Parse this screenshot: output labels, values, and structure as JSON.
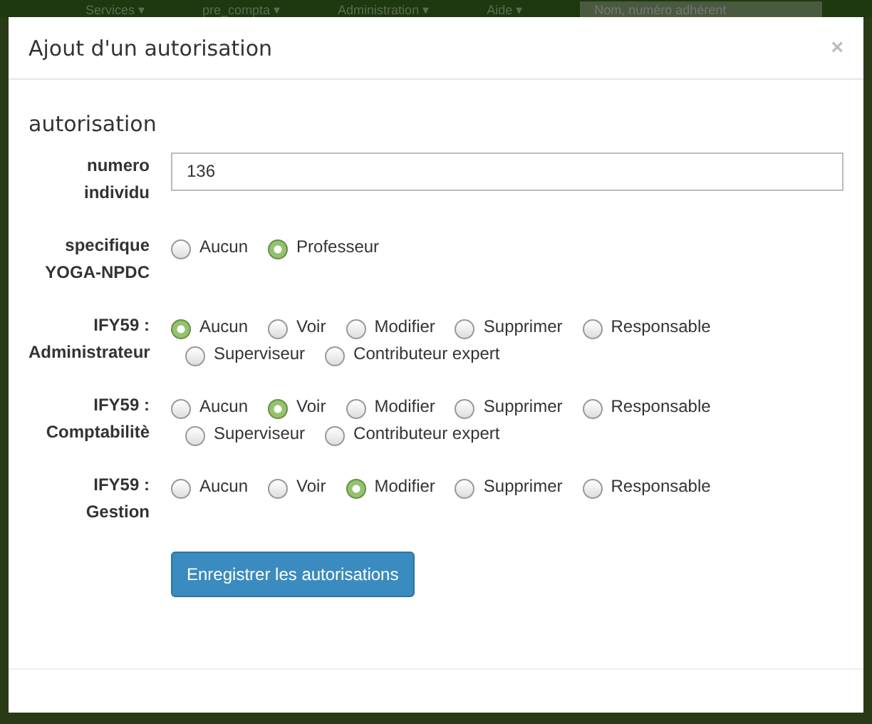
{
  "background_nav": {
    "items": [
      "Services ▾",
      "pre_compta ▾",
      "Administration ▾",
      "Aide ▾"
    ],
    "search": {
      "placeholder": "Nom, numéro adhérent"
    }
  },
  "modal": {
    "title": "Ajout d'un autorisation",
    "close": "×",
    "legend": "autorisation",
    "individual_number": {
      "label": "numero individu",
      "value": "136"
    },
    "groups": [
      {
        "label": "specifique YOGA-NPDC",
        "options": [
          {
            "label": "Aucun",
            "selected": false
          },
          {
            "label": "Professeur",
            "selected": true
          }
        ]
      },
      {
        "label": "IFY59 : Administrateur",
        "options": [
          {
            "label": "Aucun",
            "selected": true
          },
          {
            "label": "Voir",
            "selected": false
          },
          {
            "label": "Modifier",
            "selected": false
          },
          {
            "label": "Supprimer",
            "selected": false
          },
          {
            "label": "Responsable",
            "selected": false
          },
          {
            "label": "Superviseur",
            "selected": false
          },
          {
            "label": "Contributeur expert",
            "selected": false
          }
        ]
      },
      {
        "label": "IFY59 : Comptabilitè",
        "options": [
          {
            "label": "Aucun",
            "selected": false
          },
          {
            "label": "Voir",
            "selected": true
          },
          {
            "label": "Modifier",
            "selected": false
          },
          {
            "label": "Supprimer",
            "selected": false
          },
          {
            "label": "Responsable",
            "selected": false
          },
          {
            "label": "Superviseur",
            "selected": false
          },
          {
            "label": "Contributeur expert",
            "selected": false
          }
        ]
      },
      {
        "label": "IFY59 : Gestion",
        "options": [
          {
            "label": "Aucun",
            "selected": false
          },
          {
            "label": "Voir",
            "selected": false
          },
          {
            "label": "Modifier",
            "selected": true
          },
          {
            "label": "Supprimer",
            "selected": false
          },
          {
            "label": "Responsable",
            "selected": false
          }
        ]
      }
    ],
    "submit": "Enregistrer les autorisations"
  }
}
